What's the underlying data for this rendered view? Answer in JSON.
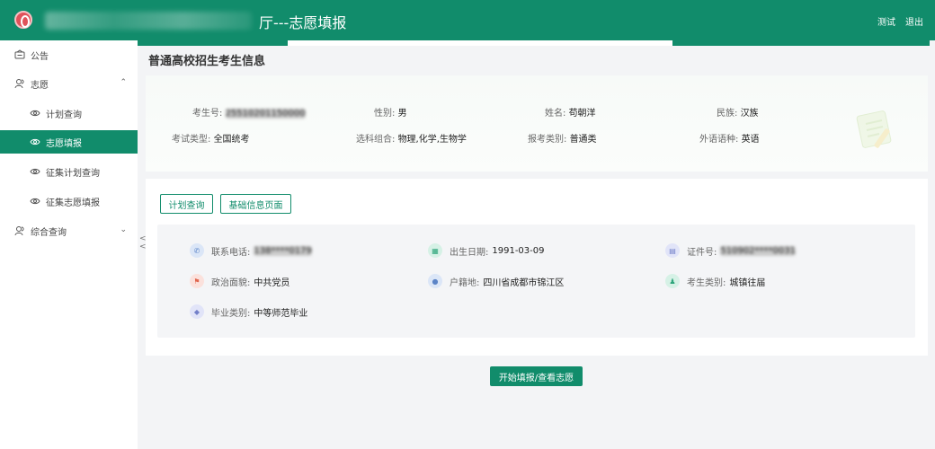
{
  "header": {
    "title": "厅---志愿填报",
    "user": "测试",
    "logout": "退出"
  },
  "sidebar": {
    "items": [
      {
        "label": "公告",
        "icon": "announcement-icon"
      },
      {
        "label": "志愿",
        "icon": "volunteer-group-icon",
        "expanded": true
      },
      {
        "label": "计划查询",
        "icon": "eye-icon"
      },
      {
        "label": "志愿填报",
        "icon": "eye-icon",
        "active": true
      },
      {
        "label": "征集计划查询",
        "icon": "eye-icon"
      },
      {
        "label": "征集志愿填报",
        "icon": "eye-icon"
      },
      {
        "label": "综合查询",
        "icon": "query-group-icon",
        "expanded": false
      }
    ],
    "collapse_glyph": "<"
  },
  "main": {
    "page_title": "普通高校招生考生信息",
    "basic_info": {
      "exam_no_label": "考生号:",
      "exam_no_value": "25510201150000",
      "gender_label": "性别:",
      "gender_value": "男",
      "name_label": "姓名:",
      "name_value": "苟朝洋",
      "ethnicity_label": "民族:",
      "ethnicity_value": "汉族",
      "exam_type_label": "考试类型:",
      "exam_type_value": "全国统考",
      "subjects_label": "选科组合:",
      "subjects_value": "物理,化学,生物学",
      "category_label": "报考类别:",
      "category_value": "普通类",
      "language_label": "外语语种:",
      "language_value": "英语"
    },
    "buttons": {
      "plan_query": "计划查询",
      "basic_info_page": "基础信息页面",
      "start": "开始填报/查看志愿"
    },
    "details": {
      "phone_label": "联系电话:",
      "phone_value": "138****0179",
      "birth_label": "出生日期:",
      "birth_value": "1991-03-09",
      "id_label": "证件号:",
      "id_value": "510902****0031",
      "political_label": "政治面貌:",
      "political_value": "中共党员",
      "hukou_label": "户籍地:",
      "hukou_value": "四川省成都市锦江区",
      "student_type_label": "考生类别:",
      "student_type_value": "城镇往届",
      "grad_type_label": "毕业类别:",
      "grad_type_value": "中等师范毕业"
    }
  },
  "colors": {
    "brand": "#118c6b",
    "page_bg": "#f3f4f6",
    "panel_bg": "#f4f5f7"
  }
}
